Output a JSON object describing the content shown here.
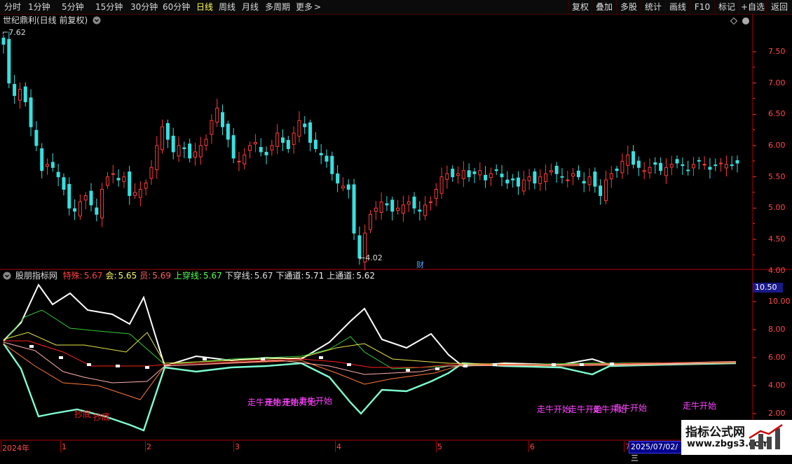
{
  "toolbar": {
    "periods": [
      "分时",
      "1分钟",
      "5分钟",
      "15分钟",
      "30分钟",
      "60分钟",
      "日线",
      "周线",
      "月线",
      "多周期",
      "更多"
    ],
    "active": "日线",
    "more_icon": "chevron-right-icon",
    "right_buttons": [
      "复权",
      "叠加",
      "多股",
      "统计",
      "画线",
      "F10",
      "标记",
      "+自选",
      "返回"
    ]
  },
  "main_chart": {
    "title": "世纪鼎利(日线 前复权)",
    "title_icon": "chevron-down-circle-icon",
    "high_label": "7.62",
    "low_label": "4.02",
    "finance_tag": "财",
    "y_ticks": [
      "7.50",
      "7.00",
      "6.50",
      "6.00",
      "5.50",
      "5.00",
      "4.50",
      "4.00"
    ],
    "colors": {
      "up": "#ff3b3b",
      "down": "#36e0e0",
      "axis": "#ff3333"
    }
  },
  "indicator": {
    "name": "股朋指标网",
    "items": [
      {
        "label": "特殊:",
        "value": "5.67",
        "color": "#ff4040"
      },
      {
        "label": "会:",
        "value": "5.65",
        "color": "#ffff66"
      },
      {
        "label": "员:",
        "value": "5.69",
        "color": "#ff6060"
      },
      {
        "label": "上穿线:",
        "value": "5.67",
        "color": "#55ff55"
      },
      {
        "label": "下穿线:",
        "value": "5.67",
        "color": "#dddddd"
      },
      {
        "label": "下通道:",
        "value": "5.71",
        "color": "#eeeeee"
      },
      {
        "label": "上通道:",
        "value": "5.62",
        "color": "#eeeeee"
      }
    ],
    "y_ticks": [
      "10.00",
      "8.00",
      "6.00",
      "4.00",
      "2.00"
    ],
    "current_value": "10.50",
    "signals": [
      {
        "text": "抄底",
        "color": "#ff2020"
      },
      {
        "text": "抄底",
        "color": "#ff2020"
      },
      {
        "text": "走牛开始",
        "color": "#ff44ff"
      },
      {
        "text": "走牛开始",
        "color": "#ff44ff"
      },
      {
        "text": "走牛开始",
        "color": "#ff44ff"
      },
      {
        "text": "走牛开始",
        "color": "#ff44ff"
      },
      {
        "text": "走牛开始",
        "color": "#ff44ff"
      },
      {
        "text": "走牛开始",
        "color": "#ff44ff"
      },
      {
        "text": "走牛开始",
        "color": "#ff44ff"
      },
      {
        "text": "走牛开始",
        "color": "#ff44ff"
      },
      {
        "text": "走牛开始",
        "color": "#ff44ff"
      }
    ]
  },
  "date_axis": {
    "labels": [
      "2024年",
      "1",
      "2",
      "3",
      "4",
      "5",
      "6",
      "7"
    ],
    "cursor_date": "2025/07/02/三"
  },
  "watermark": {
    "line1": "指标公式网",
    "line2": "www.zbgs3.com"
  }
}
